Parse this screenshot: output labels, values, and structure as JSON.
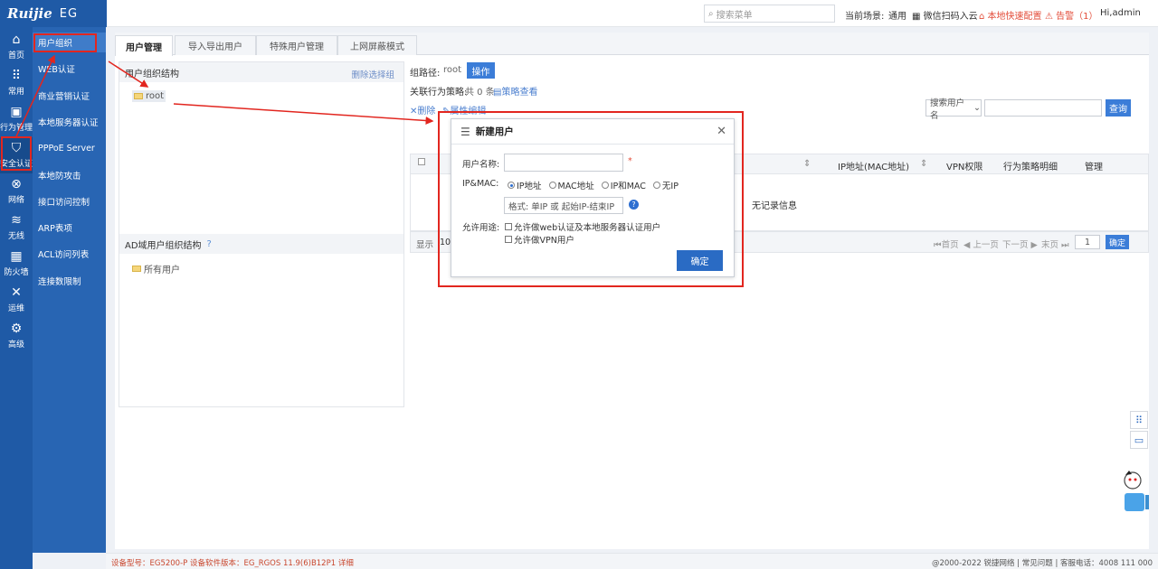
{
  "app": {
    "brand": "Ruijie",
    "product": "EG"
  },
  "topbar": {
    "search_placeholder": "搜索菜单",
    "scene_label": "当前场景:",
    "scene_value": "通用",
    "wechat": "微信扫码入云",
    "quick_config": "本地快速配置",
    "alarm": "告警（1）",
    "user": "Hi,admin"
  },
  "leftnav": [
    {
      "icon": "home-icon",
      "glyph": "⌂",
      "label": "首页"
    },
    {
      "icon": "grid-icon",
      "glyph": "⠿",
      "label": "常用"
    },
    {
      "icon": "monitor-icon",
      "glyph": "▣",
      "label": "行为管理"
    },
    {
      "icon": "shield-icon",
      "glyph": "⛉",
      "label": "安全认证"
    },
    {
      "icon": "network-icon",
      "glyph": "⊗",
      "label": "网络"
    },
    {
      "icon": "wifi-icon",
      "glyph": "≋",
      "label": "无线"
    },
    {
      "icon": "firewall-icon",
      "glyph": "▦",
      "label": "防火墙"
    },
    {
      "icon": "tools-icon",
      "glyph": "✕",
      "label": "运维"
    },
    {
      "icon": "gear-icon",
      "glyph": "⚙",
      "label": "高级"
    }
  ],
  "subnav": [
    "用户组织",
    "WEB认证",
    "商业营销认证",
    "本地服务器认证",
    "PPPoE Server",
    "本地防攻击",
    "接口访问控制",
    "ARP表项",
    "ACL访问列表",
    "连接数限制"
  ],
  "tabs": [
    "用户管理",
    "导入导出用户",
    "特殊用户管理",
    "上网屏蔽模式"
  ],
  "tree": {
    "title": "用户组织结构",
    "delete_selected": "删除选择组",
    "root": "root",
    "ad_title": "AD域用户组织结构",
    "ad_all": "所有用户"
  },
  "group": {
    "path_label": "组路径:",
    "path_value": "root",
    "operate": "操作",
    "policy_label": "关联行为策略:",
    "policy_count": "共 0 条",
    "policy_view": "策略查看",
    "delete": "删除",
    "attr_edit": "属性编辑"
  },
  "search": {
    "type": "搜索用户名",
    "query": "查询"
  },
  "table": {
    "headers": [
      "IP地址(MAC地址)",
      "VPN权限",
      "行为策略明细",
      "管理"
    ],
    "empty": "无记录信息"
  },
  "pager": {
    "show": "显示",
    "size": "10",
    "first": "首页",
    "prev": "上一页",
    "next": "下一页",
    "last": "末页",
    "page": "1",
    "confirm": "确定"
  },
  "modal": {
    "title": "新建用户",
    "username_label": "用户名称:",
    "required": "*",
    "ipmac_label": "IP&MAC:",
    "radios": [
      "IP地址",
      "MAC地址",
      "IP和MAC",
      "无IP"
    ],
    "ip_placeholder": "格式: 单IP 或 起始IP-结束IP",
    "allow_label": "允许用途:",
    "allow_web": "允许做web认证及本地服务器认证用户",
    "allow_vpn": "允许做VPN用户",
    "ok": "确定"
  },
  "footer": {
    "left": "设备型号：EG5200-P  设备软件版本：EG_RGOS 11.9(6)B12P1  详细",
    "right": "@2000-2022 锐捷网络  |  常见问题  |  客服电话：4008 111 000"
  },
  "colors": {
    "nav": "#1f5aa6",
    "subnav": "#2865b3",
    "accent": "#3b7dd8",
    "annotation": "#e2261f"
  }
}
